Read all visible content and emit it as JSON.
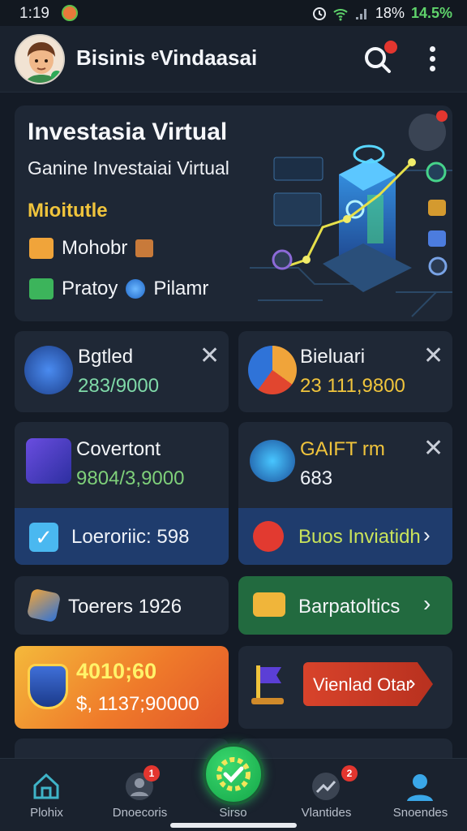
{
  "status_bar": {
    "time": "1:19",
    "battery_text": "18%",
    "battery_level": "14.5%"
  },
  "header": {
    "title": "Bisinis ᵉVindaasai",
    "search_icon": "search-icon",
    "more_icon": "more-vertical-icon"
  },
  "hero": {
    "title": "Investasia Virtual",
    "subtitle": "Ganine Investaiai Virtual",
    "accent_label": "Mioitutle",
    "row1_label": "Mohobr",
    "row2_label_a": "Pratoy",
    "row2_label_b": "Pilamr"
  },
  "cards": {
    "c1": {
      "title": "Bgtled",
      "value": "283/9000"
    },
    "c2": {
      "title": "Bieluari",
      "value": "23 111,9800"
    },
    "c3": {
      "title": "Covertont",
      "value": "9804/3,9000"
    },
    "c4": {
      "title": "GAIFT rm",
      "value": "683"
    },
    "c3_strip": {
      "label": "Loeroriic: 598"
    },
    "c4_strip": {
      "label": "Buos Inviatidh"
    },
    "c5": {
      "title": "Toerers 1926"
    },
    "c6": {
      "title": "Barpatoltics"
    },
    "c7": {
      "title": "4010;60",
      "value": "$, 1137;90000"
    },
    "c8": {
      "button_label": "Vienlad Otar"
    }
  },
  "bottom_nav": {
    "items": [
      {
        "label": "Plohix"
      },
      {
        "label": "Dnoecoris",
        "badge": "1"
      },
      {
        "label": "Sirso"
      },
      {
        "label": "Vlantides",
        "badge": "2"
      },
      {
        "label": "Snoendes"
      }
    ]
  },
  "colors": {
    "background": "#141b26",
    "card": "#1f2836",
    "accent_green": "#2fb865",
    "accent_yellow": "#f0c43c",
    "badge_red": "#e3362f"
  }
}
